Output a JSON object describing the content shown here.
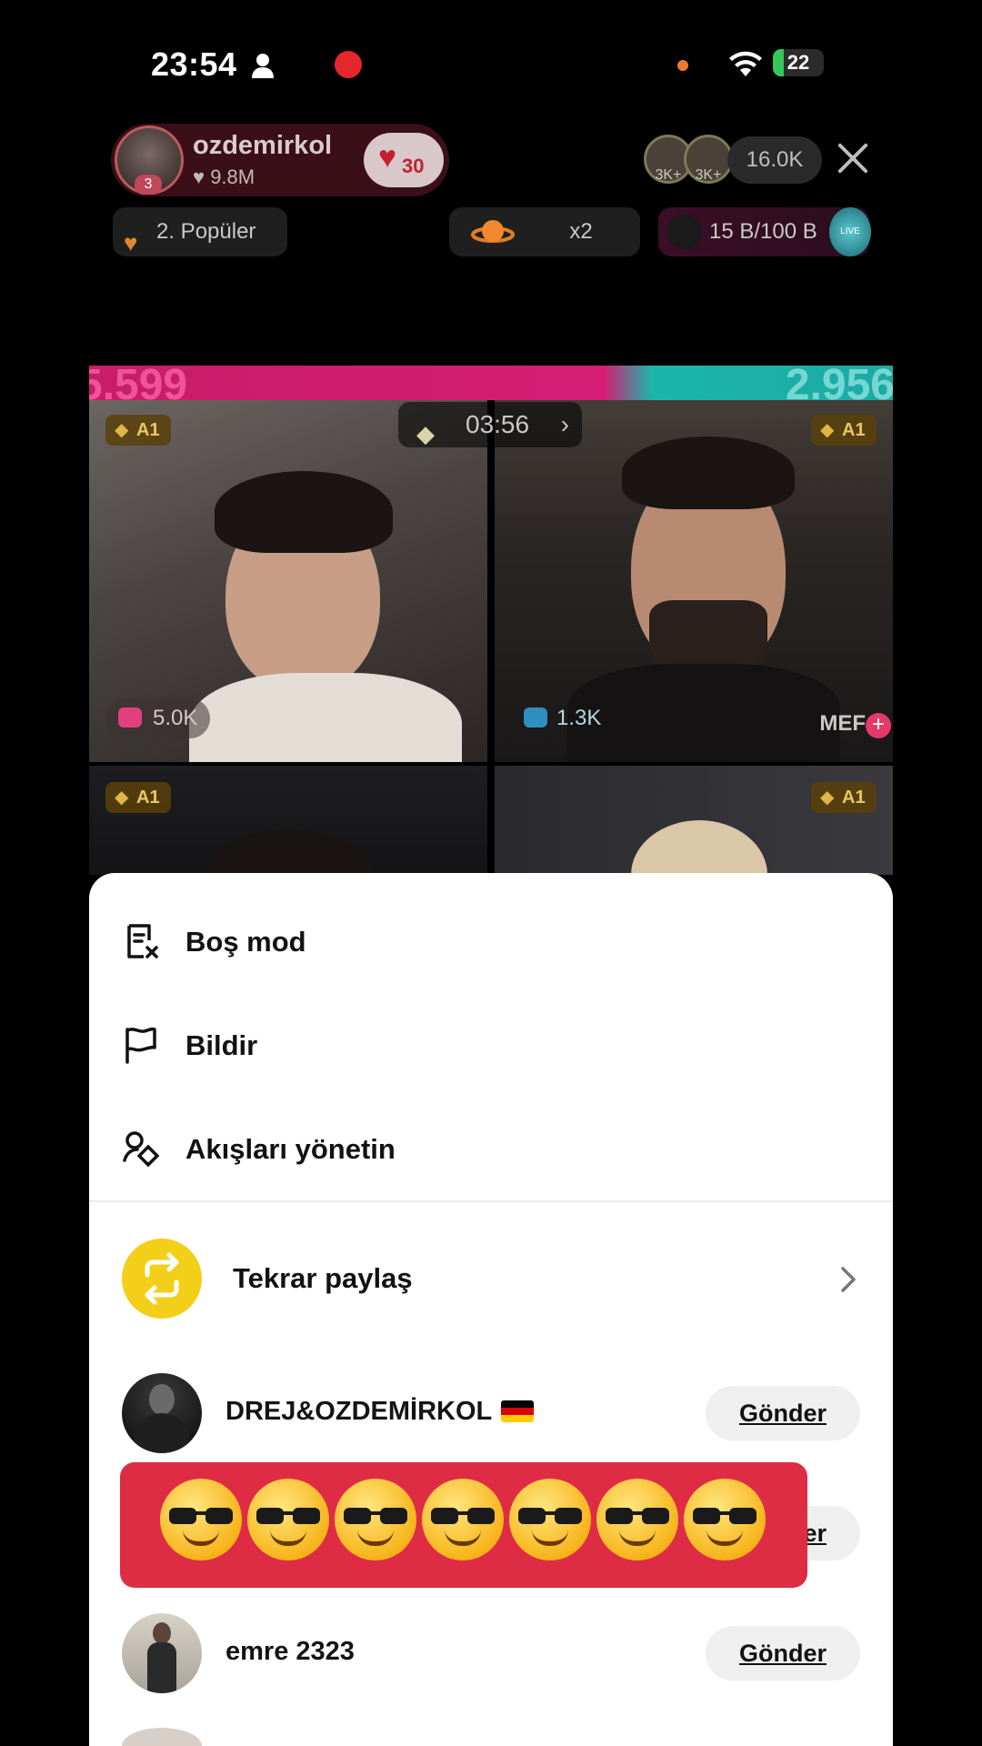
{
  "status_bar": {
    "time": "23:54",
    "battery": "22",
    "battery_level": 0.22
  },
  "header": {
    "host_name": "ozdemirkol",
    "host_likes": "9.8M",
    "host_level": "3",
    "badge_count": "30",
    "viewer_avatar_1": "3K+",
    "viewer_avatar_2": "3K+",
    "viewer_count": "16.0K",
    "popular_label": "2. Popüler",
    "multiplier": "x2",
    "gift_progress": "15 B/100 B",
    "live_label": "LIVE"
  },
  "battle": {
    "score_left": "5.599",
    "score_right": "2.956",
    "timer": "03:56",
    "tiles": [
      {
        "badge": "A1",
        "count": "5.0K"
      },
      {
        "badge": "A1",
        "count": "1.3K",
        "name": "MEF"
      },
      {
        "badge": "A1"
      },
      {
        "badge": "A1"
      }
    ]
  },
  "sheet": {
    "menu": [
      {
        "label": "Boş mod",
        "icon": "document-x-icon"
      },
      {
        "label": "Bildir",
        "icon": "flag-icon"
      },
      {
        "label": "Akışları yönetin",
        "icon": "manage-streams-icon"
      }
    ],
    "share": {
      "label": "Tekrar paylaş",
      "icon": "repost-icon"
    },
    "contacts": [
      {
        "name": "DREJ&OZDEMİRKOL",
        "flag": "germany-flag",
        "button": "Gönder"
      },
      {
        "name": "",
        "button": "Gönder"
      },
      {
        "name": "emre 2323",
        "button": "Gönder"
      }
    ]
  },
  "toast": {
    "emoji": "😎",
    "count": 7
  },
  "colors": {
    "accent_pink": "#d51d75",
    "accent_teal": "#1bb6aa",
    "share_yellow": "#f4cf1a",
    "toast_red": "#df2c45"
  }
}
